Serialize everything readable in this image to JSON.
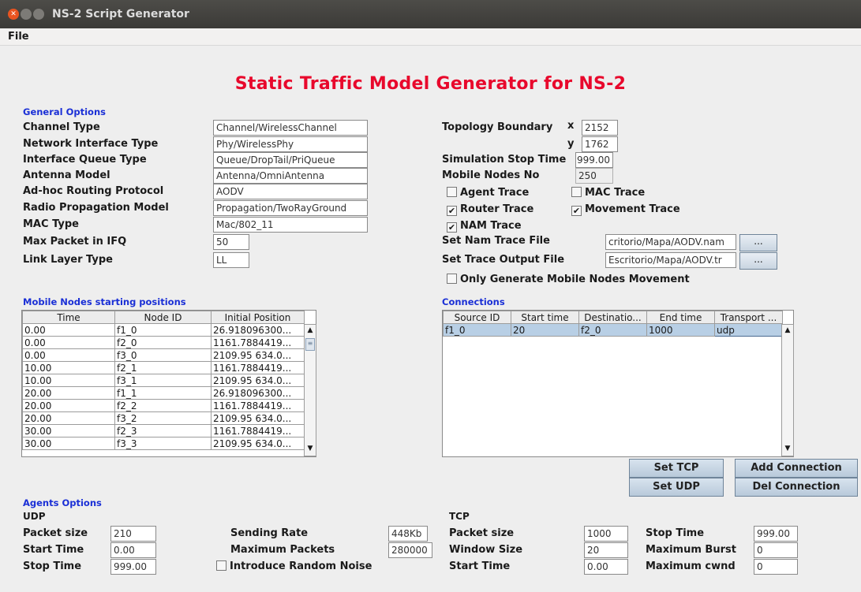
{
  "window": {
    "title": "NS-2 Script Generator"
  },
  "menu": {
    "file": "File"
  },
  "heading": "Static Traffic Model Generator for NS-2",
  "general": {
    "section": "General Options",
    "fields": [
      {
        "label": "Channel Type",
        "value": "Channel/WirelessChannel"
      },
      {
        "label": "Network Interface Type",
        "value": "Phy/WirelessPhy"
      },
      {
        "label": "Interface Queue Type",
        "value": "Queue/DropTail/PriQueue"
      },
      {
        "label": "Antenna Model",
        "value": "Antenna/OmniAntenna"
      },
      {
        "label": "Ad-hoc Routing Protocol",
        "value": "AODV"
      },
      {
        "label": "Radio Propagation Model",
        "value": "Propagation/TwoRayGround"
      },
      {
        "label": "MAC Type",
        "value": "Mac/802_11"
      },
      {
        "label": "Max Packet in IFQ",
        "value": "50"
      },
      {
        "label": "Link Layer Type",
        "value": "LL"
      }
    ]
  },
  "right": {
    "topology_label": "Topology Boundary",
    "x_label": "x",
    "x_value": "2152",
    "y_label": "y",
    "y_value": "1762",
    "stop_label": "Simulation Stop Time",
    "stop_value": "999.00",
    "nodes_label": "Mobile Nodes No",
    "nodes_value": "250",
    "agent_trace": "Agent Trace",
    "mac_trace": "MAC Trace",
    "router_trace": "Router Trace",
    "movement_trace": "Movement Trace",
    "nam_trace": "NAM Trace",
    "nam_file_label": "Set Nam Trace File",
    "nam_file_value": "critorio/Mapa/AODV.nam",
    "trace_file_label": "Set Trace Output File",
    "trace_file_value": "Escritorio/Mapa/AODV.tr",
    "browse": "...",
    "only_movement": "Only Generate Mobile Nodes Movement"
  },
  "positions": {
    "section": "Mobile Nodes starting positions",
    "columns": [
      "Time",
      "Node ID",
      "Initial Position"
    ],
    "rows": [
      [
        "0.00",
        "f1_0",
        "26.918096300..."
      ],
      [
        "0.00",
        "f2_0",
        "1161.7884419..."
      ],
      [
        "0.00",
        "f3_0",
        "2109.95 634.0..."
      ],
      [
        "10.00",
        "f2_1",
        "1161.7884419..."
      ],
      [
        "10.00",
        "f3_1",
        "2109.95 634.0..."
      ],
      [
        "20.00",
        "f1_1",
        "26.918096300..."
      ],
      [
        "20.00",
        "f2_2",
        "1161.7884419..."
      ],
      [
        "20.00",
        "f3_2",
        "2109.95 634.0..."
      ],
      [
        "30.00",
        "f2_3",
        "1161.7884419..."
      ],
      [
        "30.00",
        "f3_3",
        "2109.95 634.0..."
      ]
    ]
  },
  "connections": {
    "section": "Connections",
    "columns": [
      "Source ID",
      "Start time",
      "Destinatio...",
      "End time",
      "Transport ..."
    ],
    "rows": [
      [
        "f1_0",
        "20",
        "f2_0",
        "1000",
        "udp"
      ]
    ],
    "set_tcp": "Set TCP",
    "set_udp": "Set UDP",
    "add": "Add Connection",
    "del": "Del Connection"
  },
  "agents": {
    "section": "Agents Options",
    "udp": {
      "title": "UDP",
      "packet_size_label": "Packet size",
      "packet_size": "210",
      "start_label": "Start Time",
      "start": "0.00",
      "stop_label": "Stop Time",
      "stop": "999.00",
      "rate_label": "Sending Rate",
      "rate": "448Kb",
      "max_packets_label": "Maximum Packets",
      "max_packets": "280000",
      "noise_label": "Introduce Random Noise"
    },
    "tcp": {
      "title": "TCP",
      "packet_size_label": "Packet size",
      "packet_size": "1000",
      "window_label": "Window Size",
      "window": "20",
      "start_label": "Start Time",
      "start": "0.00",
      "stop_label": "Stop Time",
      "stop": "999.00",
      "burst_label": "Maximum Burst",
      "burst": "0",
      "cwnd_label": "Maximum cwnd",
      "cwnd": "0"
    }
  }
}
